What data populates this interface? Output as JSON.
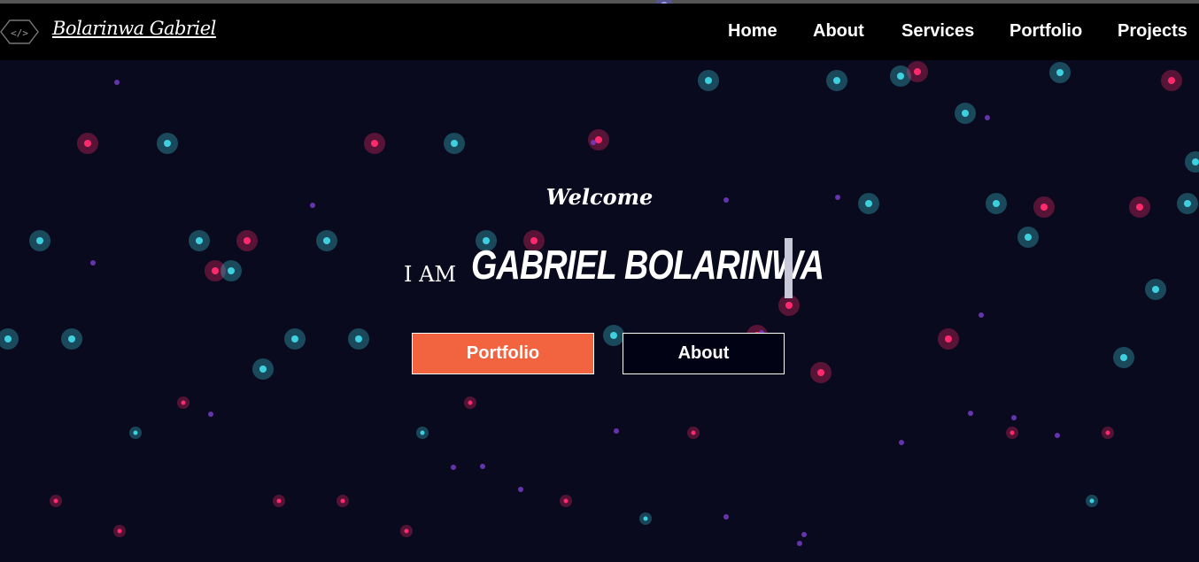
{
  "brand": {
    "name": "Bolarinwa Gabriel",
    "logo_icon": "code-brackets-icon"
  },
  "nav": {
    "links": [
      {
        "label": "Home"
      },
      {
        "label": "About"
      },
      {
        "label": "Services"
      },
      {
        "label": "Portfolio"
      },
      {
        "label": "Projects"
      }
    ]
  },
  "hero": {
    "welcome": "Welcome",
    "prefix": "I AM",
    "name": "GABRIEL BOLARINWA",
    "buttons": {
      "portfolio": "Portfolio",
      "about": "About"
    }
  },
  "colors": {
    "background": "#0a0a1e",
    "accent": "#f1643f",
    "particle_teal": "#3fd0e0",
    "particle_pink": "#ff2a6d",
    "particle_purple": "#7a3fd0"
  }
}
